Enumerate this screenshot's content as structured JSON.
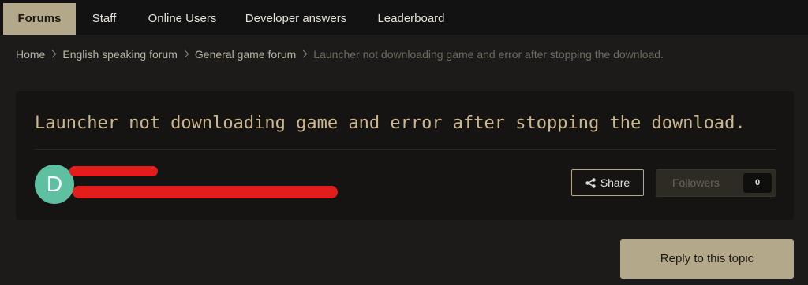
{
  "nav": {
    "tabs": [
      {
        "label": "Forums",
        "active": true
      },
      {
        "label": "Staff",
        "active": false
      },
      {
        "label": "Online Users",
        "active": false
      },
      {
        "label": "Developer answers",
        "active": false
      },
      {
        "label": "Leaderboard",
        "active": false
      }
    ]
  },
  "breadcrumb": [
    "Home",
    "English speaking forum",
    "General game forum",
    "Launcher not downloading game and error after stopping the download."
  ],
  "topic": {
    "title": "Launcher not downloading game and error after stopping the download.",
    "avatar_initial": "D",
    "avatar_color": "#5fbfa1"
  },
  "actions": {
    "share_label": "Share",
    "share_icon": "share-icon",
    "followers_label": "Followers",
    "followers_count": "0",
    "reply_label": "Reply to this topic"
  },
  "colors": {
    "accent": "#b4a88a",
    "title": "#cbb88f",
    "redaction": "#e31c1c"
  }
}
